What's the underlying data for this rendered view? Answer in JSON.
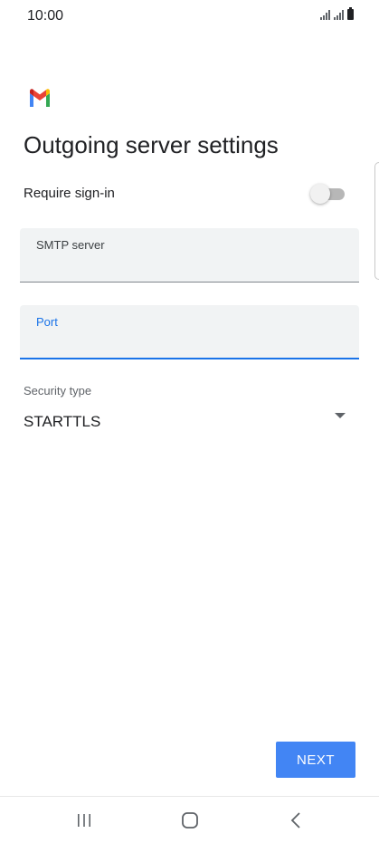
{
  "status_bar": {
    "time": "10:00"
  },
  "header": {
    "title": "Outgoing server settings"
  },
  "require_signin": {
    "label": "Require sign-in",
    "enabled": false
  },
  "smtp_server": {
    "label": "SMTP server",
    "value": ""
  },
  "port": {
    "label": "Port",
    "value": ""
  },
  "security": {
    "label": "Security type",
    "selected": "STARTTLS"
  },
  "actions": {
    "next_label": "NEXT"
  },
  "colors": {
    "accent": "#1a73e8",
    "button": "#4285f4",
    "field_bg": "#f1f3f4",
    "text_primary": "#202124"
  },
  "icons": {
    "app_logo": "gmail-logo-icon",
    "nav_recent": "recent-apps-icon",
    "nav_home": "home-icon",
    "nav_back": "back-icon"
  }
}
